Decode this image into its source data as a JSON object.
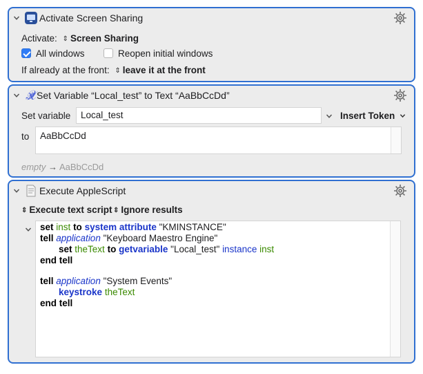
{
  "actions": [
    {
      "title": "Activate Screen Sharing",
      "activate_label": "Activate:",
      "activate_value": "Screen Sharing",
      "all_windows_label": "All windows",
      "all_windows_checked": true,
      "reopen_label": "Reopen initial windows",
      "reopen_checked": false,
      "front_label": "If already at the front:",
      "front_value": "leave it at the front"
    },
    {
      "title": "Set Variable “Local_test” to Text “AaBbCcDd”",
      "set_label": "Set variable",
      "variable_name": "Local_test",
      "insert_token_label": "Insert Token",
      "to_label": "to",
      "to_value": "AaBbCcDd",
      "preview_empty": "empty",
      "preview_arrow": "→",
      "preview_value": "AaBbCcDd"
    },
    {
      "title": "Execute AppleScript",
      "exec_mode": "Execute text script",
      "results_mode": "Ignore results",
      "code": {
        "l1": {
          "a": "set",
          "b": "inst",
          "c": "to",
          "d": "system attribute",
          "e": "\"KMINSTANCE\""
        },
        "l2": {
          "a": "tell",
          "b": "application",
          "c": "\"Keyboard Maestro Engine\""
        },
        "l3": {
          "a": "set",
          "b": "theText",
          "c": "to",
          "d": "getvariable",
          "e": "\"Local_test\"",
          "f": "instance",
          "g": "inst"
        },
        "l4": {
          "a": "end tell"
        },
        "l5": {
          "a": "tell",
          "b": "application",
          "c": "\"System Events\""
        },
        "l6": {
          "a": "keystroke",
          "b": "theText"
        },
        "l7": {
          "a": "end tell"
        }
      }
    }
  ],
  "colors": {
    "accent": "#2f6fd1",
    "keyword_blue": "#1a35c9",
    "variable_green": "#3a8a00"
  },
  "icons": [
    "chevron-down-icon",
    "screen-sharing-app-icon",
    "variable-x-icon",
    "script-document-icon",
    "gear-icon"
  ]
}
